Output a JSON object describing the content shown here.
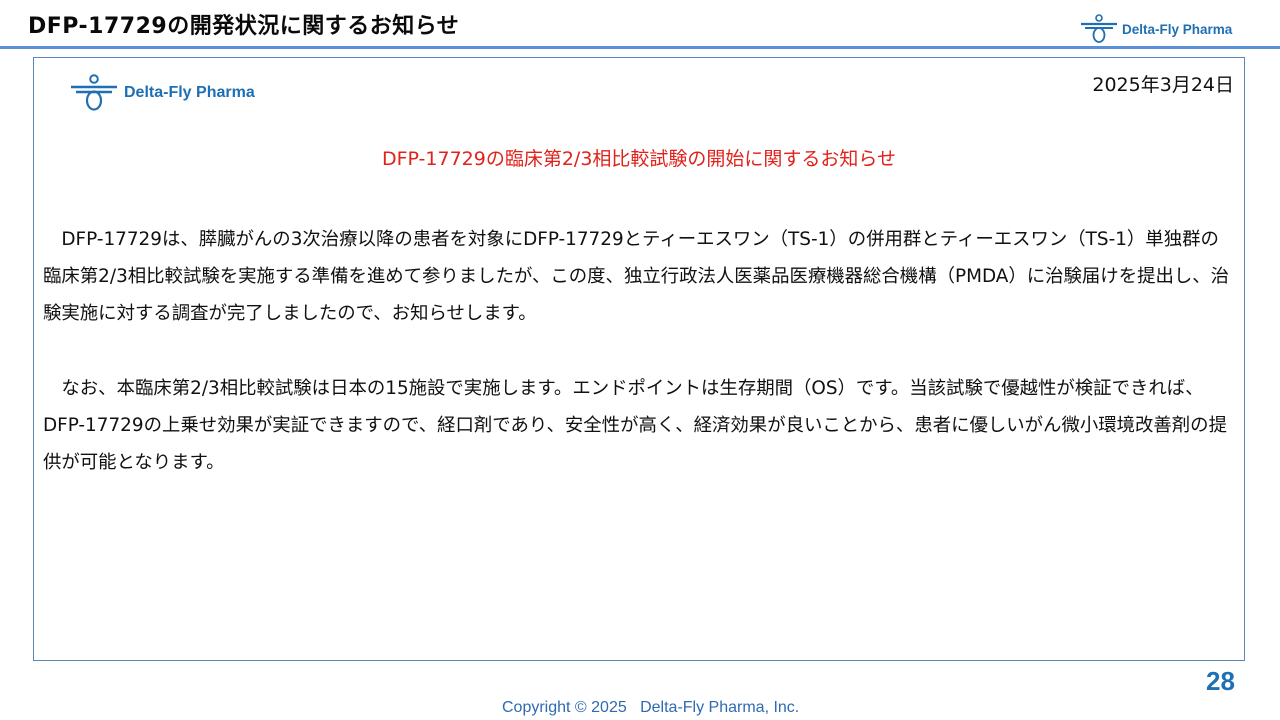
{
  "slide": {
    "title": "DFP-17729の開発状況に関するお知らせ",
    "page_number": "28",
    "copyright": "Copyright © 2025   Delta-Fly Pharma, Inc."
  },
  "brand": {
    "name": "Delta-Fly Pharma",
    "color": "#1f6fb4",
    "icon": "dragonfly-logo-icon"
  },
  "notice": {
    "date": "2025年3月24日",
    "title": "DFP-17729の臨床第2/3相比較試験の開始に関するお知らせ",
    "title_color": "#e0221b",
    "paragraphs": [
      "DFP-17729は、膵臓がんの3次治療以降の患者を対象にDFP-17729とティーエスワン（TS-1）の併用群とティーエスワン（TS-1）単独群の臨床第2/3相比較試験を実施する準備を進めて参りましたが、この度、独立行政法人医薬品医療機器総合機構（PMDA）に治験届けを提出し、治験実施に対する調査が完了しましたので、お知らせします。",
      "なお、本臨床第2/3相比較試験は日本の15施設で実施します。エンドポイントは生存期間（OS）です。当該試験で優越性が検証できれば、DFP-17729の上乗せ効果が実証できますので、経口剤であり、安全性が高く、経済効果が良いことから、患者に優しいがん微小環境改善剤の提供が可能となります。"
    ]
  }
}
